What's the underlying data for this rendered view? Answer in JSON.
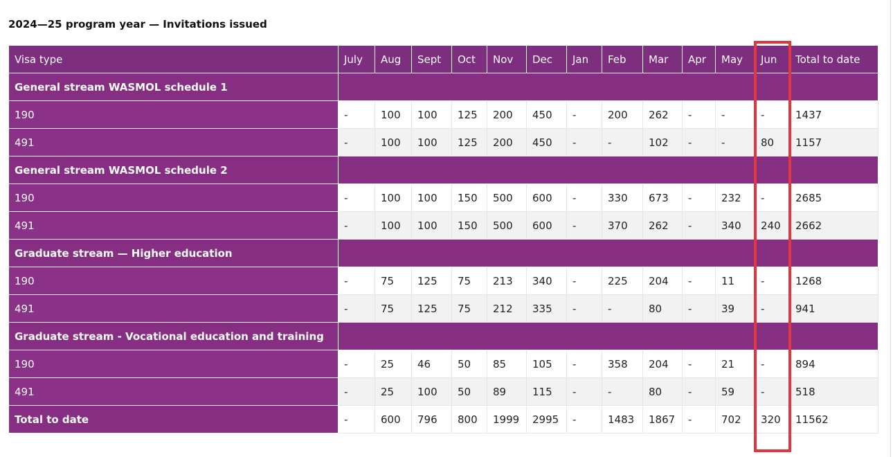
{
  "heading": "2024—25 program year — Invitations issued",
  "accent_color": "#862f82",
  "highlight_color": "#e2383d",
  "table": {
    "columns": [
      "Visa type",
      "July",
      "Aug",
      "Sept",
      "Oct",
      "Nov",
      "Dec",
      "Jan",
      "Feb",
      "Mar",
      "Apr",
      "May",
      "Jun",
      "Total to date"
    ],
    "sections": [
      {
        "title": "General stream WASMOL schedule 1",
        "rows": [
          {
            "label": "190",
            "values": [
              "-",
              "100",
              "100",
              "125",
              "200",
              "450",
              "-",
              "200",
              "262",
              "-",
              "-",
              "-",
              "1437"
            ]
          },
          {
            "label": "491",
            "values": [
              "-",
              "100",
              "100",
              "125",
              "200",
              "450",
              "-",
              "-",
              "102",
              "-",
              "-",
              "80",
              "1157"
            ]
          }
        ]
      },
      {
        "title": "General stream WASMOL schedule 2",
        "rows": [
          {
            "label": "190",
            "values": [
              "-",
              "100",
              "100",
              "150",
              "500",
              "600",
              "-",
              "330",
              "673",
              "-",
              "232",
              "-",
              "2685"
            ]
          },
          {
            "label": "491",
            "values": [
              "-",
              "100",
              "100",
              "150",
              "500",
              "600",
              "-",
              "370",
              "262",
              "-",
              "340",
              "240",
              "2662"
            ]
          }
        ]
      },
      {
        "title": "Graduate stream — Higher education",
        "rows": [
          {
            "label": "190",
            "values": [
              "-",
              "75",
              "125",
              "75",
              "213",
              "340",
              "-",
              "225",
              "204",
              "-",
              "11",
              "-",
              "1268"
            ]
          },
          {
            "label": "491",
            "values": [
              "-",
              "75",
              "125",
              "75",
              "212",
              "335",
              "-",
              "-",
              "80",
              "-",
              "39",
              "-",
              "941"
            ]
          }
        ]
      },
      {
        "title": "Graduate stream - Vocational education and training",
        "rows": [
          {
            "label": "190",
            "values": [
              "-",
              "25",
              "46",
              "50",
              "85",
              "105",
              "-",
              "358",
              "204",
              "-",
              "21",
              "-",
              "894"
            ]
          },
          {
            "label": "491",
            "values": [
              "-",
              "25",
              "100",
              "50",
              "89",
              "115",
              "-",
              "-",
              "80",
              "-",
              "59",
              "-",
              "518"
            ]
          }
        ]
      }
    ],
    "total": {
      "label": "Total to date",
      "values": [
        "-",
        "600",
        "796",
        "800",
        "1999",
        "2995",
        "-",
        "1483",
        "1867",
        "-",
        "702",
        "320",
        "11562"
      ]
    }
  }
}
